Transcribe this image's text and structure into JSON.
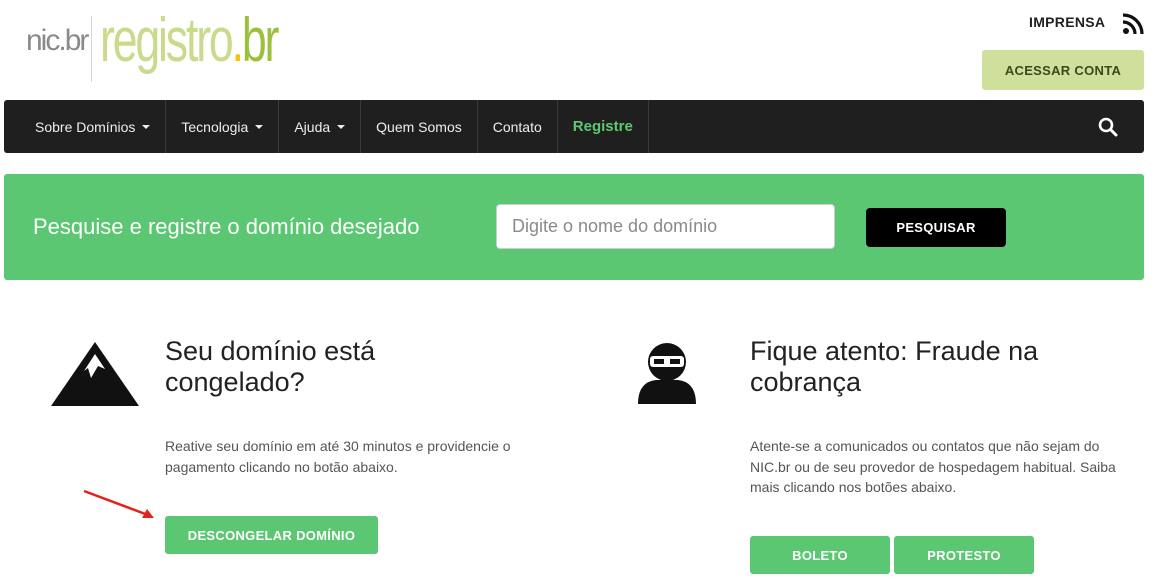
{
  "header": {
    "logo_nic": "nic.br",
    "logo_registro": "registro.br",
    "imprensa_label": "IMPRENSA",
    "acessar_conta_label": "ACESSAR CONTA"
  },
  "navbar": {
    "items": [
      {
        "label": "Sobre Domínios",
        "dropdown": true
      },
      {
        "label": "Tecnologia",
        "dropdown": true
      },
      {
        "label": "Ajuda",
        "dropdown": true
      },
      {
        "label": "Quem Somos",
        "dropdown": false
      },
      {
        "label": "Contato",
        "dropdown": false
      },
      {
        "label": "Registre",
        "dropdown": false
      }
    ],
    "search_icon": "search-icon"
  },
  "banner": {
    "title": "Pesquise e registre o domínio desejado",
    "input_placeholder": "Digite o nome do domínio",
    "input_value": "",
    "search_button_label": "PESQUISAR"
  },
  "left_column": {
    "icon": "mountain-icon",
    "title": "Seu domínio está congelado?",
    "text": "Reative seu domínio em até 30 minutos e providencie o pagamento clicando no botão abaixo.",
    "button_label": "DESCONGELAR DOMÍNIO"
  },
  "right_column": {
    "icon": "ninja-icon",
    "title": "Fique atento: Fraude na cobrança",
    "text": "Atente-se a comunicados ou contatos que não sejam do NIC.br ou de seu provedor de hospedagem habitual. Saiba mais clicando nos botões abaixo.",
    "buttons": [
      "BOLETO",
      "PROTESTO"
    ]
  },
  "colors": {
    "green": "#5bc772",
    "navbar_bg": "#1f1f1f",
    "acessar_bg": "#cfe09c",
    "registre_text": "#5cc96f",
    "arrow": "#e8201a"
  }
}
